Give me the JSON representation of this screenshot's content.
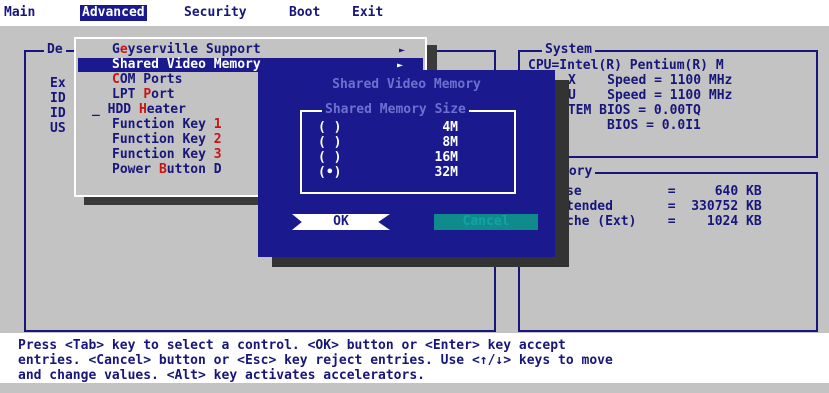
{
  "menubar": {
    "items": [
      "Main",
      "Advanced",
      "Security",
      "Boot",
      "Exit"
    ],
    "selected": "Advanced"
  },
  "left_panel": {
    "title": "De",
    "rows": [
      "Ex",
      "ID",
      "ID",
      "US"
    ]
  },
  "advanced_menu": {
    "items": [
      {
        "before": "G",
        "hot": "e",
        "after": "yserville Support",
        "arrow": "►"
      },
      {
        "before": "Shared Video Memory",
        "hot": "",
        "after": "",
        "arrow": "►"
      },
      {
        "before": "",
        "hot": "C",
        "after": "OM Ports",
        "arrow": "►"
      },
      {
        "before": "LPT ",
        "hot": "P",
        "after": "ort",
        "arrow": ""
      },
      {
        "before": "HDD ",
        "hot": "H",
        "after": "eater",
        "arrow": ""
      },
      {
        "before": "Function Key ",
        "hot": "1",
        "after": "",
        "arrow": ""
      },
      {
        "before": "Function Key ",
        "hot": "2",
        "after": "",
        "arrow": ""
      },
      {
        "before": "Function Key ",
        "hot": "3",
        "after": "",
        "arrow": ""
      },
      {
        "before": "Power ",
        "hot": "B",
        "after": "utton D",
        "arrow": ""
      }
    ]
  },
  "system_panel": {
    "title": "System",
    "lines": [
      "CPU=Intel(R) Pentium(R) M",
      "X    Speed = 1100 MHz",
      "U    Speed = 1100 MHz",
      "STEM BIOS = 0.00TQ",
      "      BIOS = 0.0I1"
    ]
  },
  "memory_panel": {
    "title": "mory",
    "lines": [
      "se           =     640 KB",
      "tended       =  330752 KB",
      "che (Ext)    =    1024 KB"
    ]
  },
  "dialog": {
    "title": "Shared Video Memory",
    "group_title": "Shared Memory Size",
    "options": [
      {
        "radio": "( )",
        "label": "4M"
      },
      {
        "radio": "( )",
        "label": "8M"
      },
      {
        "radio": "( )",
        "label": "16M"
      },
      {
        "radio": "(•)",
        "label": "32M"
      }
    ],
    "ok_label": "OK",
    "cancel_label": "Cancel"
  },
  "status": {
    "lines": [
      "Press <Tab> key to select a control. <OK> button or <Enter> key accept",
      "entries. <Cancel> button or <Esc> key reject entries. Use <↑/↓> keys to move",
      "and change values. <Alt> key activates accelerators."
    ]
  }
}
